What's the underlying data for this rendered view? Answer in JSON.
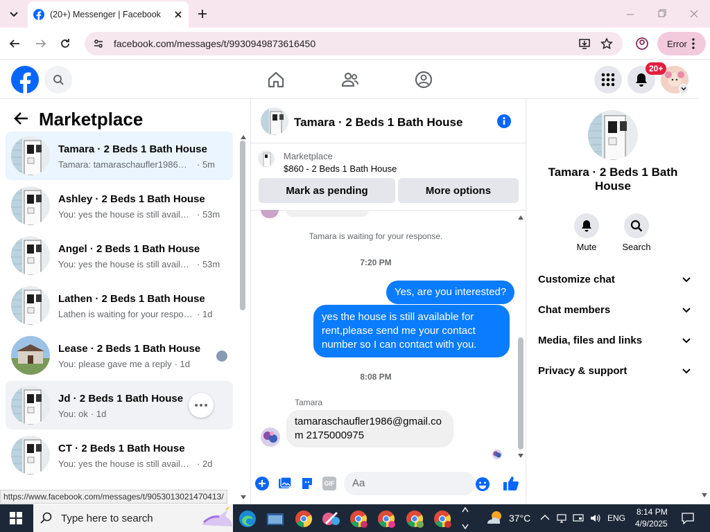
{
  "browser": {
    "tab_title": "(20+) Messenger | Facebook",
    "url": "facebook.com/messages/t/9930949873616450",
    "profile_button": "Error",
    "status_url": "https://www.facebook.com/messages/t/9053013021470413/"
  },
  "fb": {
    "notification_badge": "20+"
  },
  "left": {
    "title": "Marketplace",
    "threads": [
      {
        "name": "Tamara · 2 Beds 1 Bath House",
        "preview": "Tamara: tamaraschaufler1986@gm...",
        "time": "· 5m",
        "selected": true
      },
      {
        "name": "Ashley · 2 Beds 1 Bath House",
        "preview": "You: yes the house is still availabl...",
        "time": "· 53m"
      },
      {
        "name": "Angel · 2 Beds 1 Bath House",
        "preview": "You: yes the house is still availabl...",
        "time": "· 53m"
      },
      {
        "name": "Lathen · 2 Beds 1 Bath House",
        "preview": "Lathen is waiting for your response.",
        "time": "· 1d"
      },
      {
        "name": "Lease · 2 Beds 1 Bath House",
        "preview": "You: please gave me a reply",
        "time": "· 1d"
      },
      {
        "name": "Jd · 2 Beds 1 Bath House",
        "preview": "You: ok",
        "time": "· 1d"
      },
      {
        "name": "CT · 2 Beds 1 Bath House",
        "preview": "You: yes the house is still available f...",
        "time": "· 2d"
      }
    ]
  },
  "chat": {
    "title": "Tamara · 2 Beds 1 Bath House",
    "listing_label": "Marketplace",
    "listing_detail": "$860 - 2 Beds 1 Bath House",
    "mark_pending": "Mark as pending",
    "more_options": "More options",
    "waiting_text": "Tamara is waiting for your response.",
    "time1": "7:20 PM",
    "msg_out1": "Yes, are you interested?",
    "msg_out2": "yes the house is still available for rent,please send me your contact number so I can contact with you.",
    "time2": "8:08 PM",
    "sender": "Tamara",
    "msg_in": "tamaraschaufler1986@gmail.com 2175000975",
    "compose_placeholder": "Aa"
  },
  "info": {
    "title": "Tamara · 2 Beds 1 Bath House",
    "mute": "Mute",
    "search": "Search",
    "sections": [
      "Customize chat",
      "Chat members",
      "Media, files and links",
      "Privacy & support"
    ]
  },
  "taskbar": {
    "search_placeholder": "Type here to search",
    "weather": "37°C",
    "lang": "ENG",
    "time": "8:14 PM",
    "date": "4/9/2025"
  }
}
